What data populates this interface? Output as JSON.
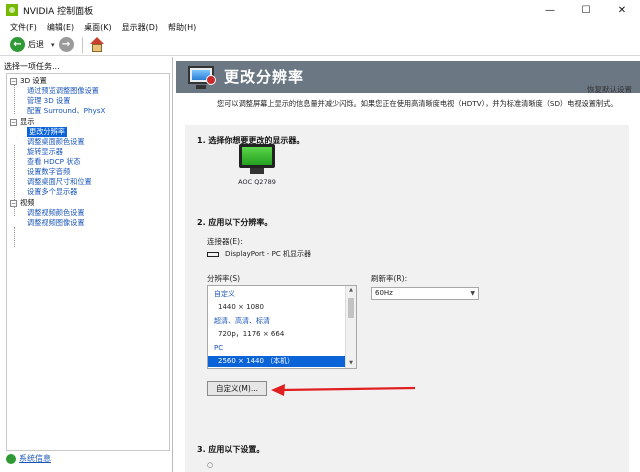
{
  "window": {
    "title": "NVIDIA 控制面板",
    "minimize": "—",
    "maximize": "☐",
    "close": "✕"
  },
  "menu": [
    "文件(F)",
    "编辑(E)",
    "桌面(K)",
    "显示器(D)",
    "帮助(H)"
  ],
  "toolbar": {
    "back_label": "后退",
    "dropdown": "▾"
  },
  "left_pane": {
    "task_label": "选择一项任务...",
    "tree": [
      {
        "type": "category",
        "label": "3D 设置",
        "expander": "−"
      },
      {
        "type": "leaf",
        "label": "通过预览调整图像设置"
      },
      {
        "type": "leaf",
        "label": "管理 3D 设置"
      },
      {
        "type": "leaf",
        "label": "配置 Surround、PhysX"
      },
      {
        "type": "category",
        "label": "显示",
        "expander": "−"
      },
      {
        "type": "leaf",
        "label": "更改分辨率",
        "selected": true
      },
      {
        "type": "leaf",
        "label": "调整桌面颜色设置"
      },
      {
        "type": "leaf",
        "label": "旋转显示器"
      },
      {
        "type": "leaf",
        "label": "查看 HDCP 状态"
      },
      {
        "type": "leaf",
        "label": "设置数字音频"
      },
      {
        "type": "leaf",
        "label": "调整桌面尺寸和位置"
      },
      {
        "type": "leaf",
        "label": "设置多个显示器"
      },
      {
        "type": "category",
        "label": "视频",
        "expander": "−"
      },
      {
        "type": "leaf",
        "label": "调整视频颜色设置"
      },
      {
        "type": "leaf",
        "label": "调整视频图像设置"
      }
    ],
    "system_info": "系统信息"
  },
  "main": {
    "title": "更改分辨率",
    "restore_defaults": "恢复默认设置",
    "description": "您可以调整屏幕上显示的信息量并减少闪烁。如果您正在使用高清晰度电视（HDTV），并为标准清晰度（SD）电视设置制式。",
    "section1_title": "1. 选择你想要更改的显示器。",
    "display_name": "AOC Q2789",
    "section2_title": "2. 应用以下分辨率。",
    "connector_label": "连接器(E):",
    "connector_value": "DisplayPort - PC 机显示器",
    "resolution_label": "分辨率(S)",
    "refresh_label": "刷新率(R):",
    "refresh_value": "60Hz",
    "resolution_list": [
      {
        "type": "group",
        "label": "自定义"
      },
      {
        "type": "item",
        "label": "1440 × 1080"
      },
      {
        "type": "group",
        "label": "超清、高清、标清"
      },
      {
        "type": "item",
        "label": "720p，1176 × 664"
      },
      {
        "type": "group",
        "label": "PC"
      },
      {
        "type": "item",
        "label": "2560 × 1440 （本机）",
        "selected": true
      }
    ],
    "custom_button": "自定义(M)...",
    "section3_title": "3. 应用以下设置。",
    "annotation_color": "#e02020"
  }
}
